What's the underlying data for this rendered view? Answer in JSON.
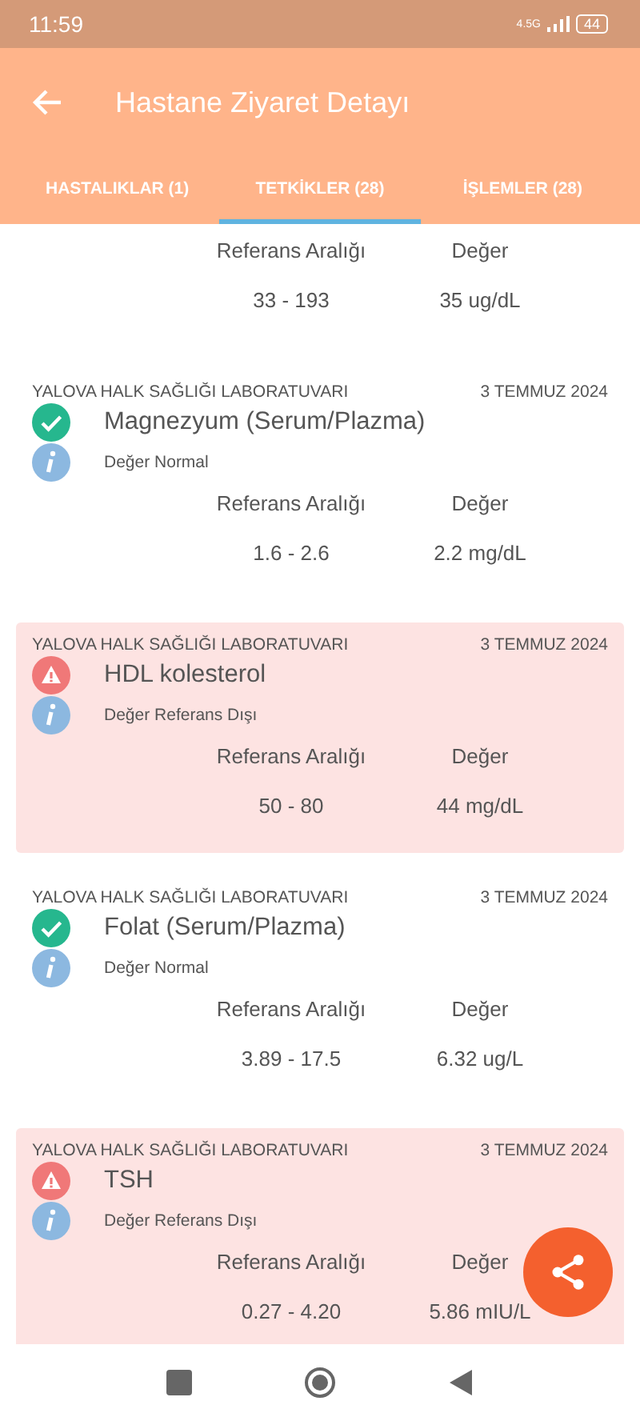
{
  "status_bar": {
    "time": "11:59",
    "network": "4.5G",
    "battery": "44"
  },
  "app_bar": {
    "title": "Hastane Ziyaret Detayı"
  },
  "tabs": [
    {
      "label": "HASTALIKLAR (1)",
      "selected": false
    },
    {
      "label": "TETKİKLER (28)",
      "selected": true
    },
    {
      "label": "İŞLEMLER (28)",
      "selected": false
    }
  ],
  "results": [
    {
      "ref_label": "Referans Aralığı",
      "value_label": "Değer",
      "range": "33 - 193",
      "value": "35 ug/dL"
    },
    {
      "kind": "normal",
      "lab": "YALOVA HALK SAĞLIĞI LABORATUVARI",
      "date": "3 TEMMUZ 2024",
      "name": "Magnezyum (Serum/Plazma)",
      "status": "Değer Normal",
      "ref_label": "Referans Aralığı",
      "value_label": "Değer",
      "range": "1.6 - 2.6",
      "value": "2.2 mg/dL"
    },
    {
      "kind": "abnormal",
      "lab": "YALOVA HALK SAĞLIĞI LABORATUVARI",
      "date": "3 TEMMUZ 2024",
      "name": "HDL kolesterol",
      "status": "Değer Referans Dışı",
      "ref_label": "Referans Aralığı",
      "value_label": "Değer",
      "range": "50 - 80",
      "value": "44 mg/dL"
    },
    {
      "kind": "normal",
      "lab": "YALOVA HALK SAĞLIĞI LABORATUVARI",
      "date": "3 TEMMUZ 2024",
      "name": "Folat (Serum/Plazma)",
      "status": "Değer Normal",
      "ref_label": "Referans Aralığı",
      "value_label": "Değer",
      "range": "3.89 - 17.5",
      "value": "6.32 ug/L"
    },
    {
      "kind": "abnormal",
      "lab": "YALOVA HALK SAĞLIĞI LABORATUVARI",
      "date": "3 TEMMUZ 2024",
      "name": "TSH",
      "status": "Değer Referans Dışı",
      "ref_label": "Referans Aralığı",
      "value_label": "Değer",
      "range": "0.27 - 4.20",
      "value": "5.86 mIU/L"
    }
  ]
}
